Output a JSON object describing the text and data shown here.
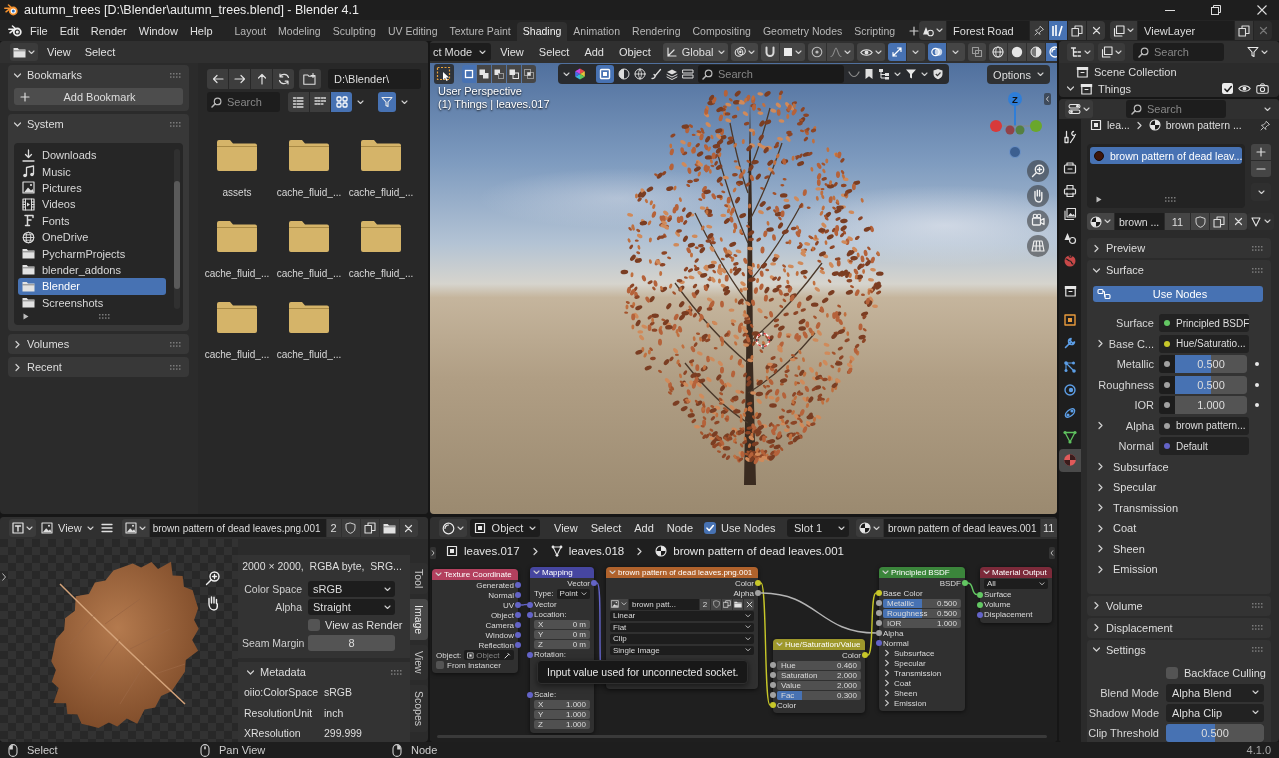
{
  "window": {
    "title": "autumn_trees [D:\\Blender\\autumn_trees.blend] - Blender 4.1"
  },
  "menu": [
    "File",
    "Edit",
    "Render",
    "Window",
    "Help"
  ],
  "workspaces": [
    {
      "label": "Layout",
      "selected": false
    },
    {
      "label": "Modeling",
      "selected": false
    },
    {
      "label": "Sculpting",
      "selected": false
    },
    {
      "label": "UV Editing",
      "selected": false
    },
    {
      "label": "Texture Paint",
      "selected": false
    },
    {
      "label": "Shading",
      "selected": true
    },
    {
      "label": "Animation",
      "selected": false
    },
    {
      "label": "Rendering",
      "selected": false
    },
    {
      "label": "Compositing",
      "selected": false
    },
    {
      "label": "Geometry Nodes",
      "selected": false
    },
    {
      "label": "Scripting",
      "selected": false
    }
  ],
  "scene": {
    "name": "Forest Road"
  },
  "view_layer": {
    "name": "ViewLayer"
  },
  "file_browser": {
    "menu": [
      "View",
      "Select"
    ],
    "panels": [
      {
        "kind": "bookmarks",
        "title": "Bookmarks",
        "expanded": true,
        "button": "Add Bookmark"
      },
      {
        "kind": "system",
        "title": "System",
        "expanded": true,
        "items": [
          {
            "kind": "download",
            "label": "Downloads",
            "selected": false
          },
          {
            "kind": "music",
            "label": "Music",
            "selected": false
          },
          {
            "kind": "pictures",
            "label": "Pictures",
            "selected": false
          },
          {
            "kind": "videos",
            "label": "Videos",
            "selected": false
          },
          {
            "kind": "fonts",
            "label": "Fonts",
            "selected": false
          },
          {
            "kind": "network",
            "label": "OneDrive",
            "selected": false
          },
          {
            "kind": "folder",
            "label": "PycharmProjects",
            "selected": false
          },
          {
            "kind": "folder",
            "label": "blender_addons",
            "selected": false
          },
          {
            "kind": "folder",
            "label": "Blender",
            "selected": true
          },
          {
            "kind": "folder",
            "label": "Screenshots",
            "selected": false
          }
        ]
      },
      {
        "title": "Volumes",
        "expanded": false
      },
      {
        "title": "Recent",
        "expanded": false
      }
    ],
    "path": "D:\\Blender\\",
    "search": {
      "placeholder": "Search"
    },
    "display_modes": [
      {
        "kind": "vertical_list",
        "selected": false
      },
      {
        "kind": "horizontal_list",
        "selected": false
      },
      {
        "kind": "thumbnails",
        "selected": true
      }
    ],
    "filter_on": true,
    "files": [
      "assets",
      "cache_fluid_...",
      "cache_fluid_...",
      "cache_fluid_...",
      "cache_fluid_...",
      "cache_fluid_...",
      "cache_fluid_...",
      "cache_fluid_..."
    ]
  },
  "viewport": {
    "mode": "ct Mode",
    "menu": [
      "View",
      "Select",
      "Add",
      "Object"
    ],
    "orientation": "Global",
    "toggles": {
      "snap": false,
      "proportional": false,
      "gizmos": true,
      "overlays": true,
      "xray": false
    },
    "shading": [
      {
        "kind": "wireframe",
        "selected": false
      },
      {
        "kind": "solid",
        "selected": false
      },
      {
        "kind": "material",
        "selected": false
      },
      {
        "kind": "rendered",
        "selected": true
      }
    ],
    "select_modes": [
      {
        "kind": "set",
        "selected": true
      },
      {
        "kind": "extend",
        "selected": false
      },
      {
        "kind": "subtract",
        "selected": false
      },
      {
        "kind": "invert",
        "selected": false
      },
      {
        "kind": "intersect",
        "selected": false
      }
    ],
    "search": {
      "placeholder": "Search"
    },
    "options": "Options",
    "overlay_text": [
      "User Perspective",
      "(1) Things | leaves.017"
    ],
    "axis_label": "Z"
  },
  "image_editor": {
    "menu": [
      "View"
    ],
    "image": {
      "name": "brown pattern of dead leaves.png.001",
      "users": "2"
    },
    "info": "2000 × 2000,  RGBA byte,  SRG...",
    "fields": [
      {
        "kind": "dropdown",
        "label": "Color Space",
        "value": "sRGB"
      },
      {
        "kind": "dropdown",
        "label": "Alpha",
        "value": "Straight"
      },
      {
        "kind": "checkbox",
        "label": "View as Render",
        "checked": false
      },
      {
        "kind": "number",
        "label": "Seam Margin",
        "value": "8"
      }
    ],
    "metadata": {
      "title": "Metadata",
      "expanded": true,
      "rows": [
        {
          "key": "oiio:ColorSpace",
          "value": "sRGB"
        },
        {
          "key": "ResolutionUnit",
          "value": "inch"
        },
        {
          "key": "XResolution",
          "value": "299.999"
        }
      ]
    },
    "tabs": [
      {
        "label": "Tool",
        "selected": false
      },
      {
        "label": "Image",
        "selected": true
      },
      {
        "label": "View",
        "selected": false
      },
      {
        "label": "Scopes",
        "selected": false
      }
    ]
  },
  "node_editor": {
    "object_type": "Object",
    "menu": [
      "View",
      "Select",
      "Add",
      "Node"
    ],
    "use_nodes": {
      "label": "Use Nodes",
      "checked": true
    },
    "slot": "Slot 1",
    "material": {
      "name": "brown pattern of dead leaves.001",
      "users": "11"
    },
    "breadcrumbs": [
      {
        "kind": "object",
        "label": "leaves.017"
      },
      {
        "kind": "mesh",
        "label": "leaves.018"
      },
      {
        "kind": "material",
        "label": "brown pattern of dead leaves.001"
      }
    ],
    "nodes": [
      {
        "title": "Texture Coordinate",
        "color": "#b3405e",
        "rows": [
          {
            "kind": "output",
            "label": "Generated",
            "color": "#6363c7"
          },
          {
            "kind": "output",
            "label": "Normal",
            "color": "#6363c7"
          },
          {
            "kind": "output",
            "label": "UV",
            "color": "#6363c7"
          },
          {
            "kind": "output",
            "label": "Object",
            "color": "#6363c7"
          },
          {
            "kind": "output",
            "label": "Camera",
            "color": "#6363c7"
          },
          {
            "kind": "output",
            "label": "Window",
            "color": "#6363c7"
          },
          {
            "kind": "output",
            "label": "Reflection",
            "color": "#6363c7"
          },
          {
            "kind": "object_field",
            "label": "Object:",
            "placeholder": "Object"
          },
          {
            "kind": "checkbox",
            "label": "From Instancer",
            "checked": false
          }
        ]
      },
      {
        "title": "Mapping",
        "color": "#4646a0",
        "rows": [
          {
            "kind": "output",
            "label": "Vector",
            "color": "#6363c7"
          },
          {
            "kind": "dropdown",
            "label": "Type:",
            "value": "Point"
          },
          {
            "kind": "input",
            "label": "Vector",
            "color": "#6363c7"
          },
          {
            "kind": "input",
            "label": "Location:",
            "color": "#6363c7"
          },
          {
            "kind": "field",
            "label": "X",
            "value": "0 m"
          },
          {
            "kind": "field",
            "label": "Y",
            "value": "0 m"
          },
          {
            "kind": "field",
            "label": "Z",
            "value": "0 m"
          },
          {
            "kind": "input",
            "label": "Rotation:",
            "color": "#6363c7"
          },
          {
            "kind": "blank"
          },
          {
            "kind": "blank"
          },
          {
            "kind": "blank"
          },
          {
            "kind": "input",
            "label": "Scale:",
            "color": "#6363c7"
          },
          {
            "kind": "field",
            "label": "X",
            "value": "1.000"
          },
          {
            "kind": "field",
            "label": "Y",
            "value": "1.000"
          },
          {
            "kind": "field",
            "label": "Z",
            "value": "1.000"
          }
        ]
      },
      {
        "title": "brown pattern of dead leaves.png.001",
        "color": "#b0622c",
        "rows": [
          {
            "kind": "output",
            "label": "Color",
            "color": "#c7c729"
          },
          {
            "kind": "output",
            "label": "Alpha",
            "color": "#a1a1a1"
          },
          {
            "kind": "image_select",
            "value": "brown patt...",
            "users": "2"
          },
          {
            "kind": "dropdown",
            "value": "Linear"
          },
          {
            "kind": "dropdown",
            "value": "Flat"
          },
          {
            "kind": "dropdown",
            "value": "Clip"
          },
          {
            "kind": "dropdown",
            "value": "Single Image"
          },
          {
            "kind": "blank"
          },
          {
            "kind": "blank"
          },
          {
            "kind": "blank"
          }
        ]
      },
      {
        "title": "Hue/Saturation/Value",
        "color": "#9e982c",
        "rows": [
          {
            "kind": "output",
            "label": "Color",
            "color": "#c7c729"
          },
          {
            "kind": "field",
            "label": "Hue",
            "value": "0.460",
            "color": "#a1a1a1"
          },
          {
            "kind": "field",
            "label": "Saturation",
            "value": "2.000",
            "color": "#a1a1a1"
          },
          {
            "kind": "field",
            "label": "Value",
            "value": "2.000",
            "color": "#a1a1a1"
          },
          {
            "kind": "slider",
            "label": "Fac",
            "value": "0.300",
            "level": 0.3,
            "color": "#a1a1a1"
          },
          {
            "kind": "input",
            "label": "Color",
            "color": "#c7c729"
          }
        ]
      },
      {
        "title": "Principled BSDF",
        "color": "#3b853b",
        "rows": [
          {
            "kind": "output",
            "label": "BSDF",
            "color": "#63c763"
          },
          {
            "kind": "input",
            "label": "Base Color",
            "color": "#c7c729"
          },
          {
            "kind": "slider",
            "label": "Metallic",
            "value": "0.500",
            "level": 0.5,
            "color": "#a1a1a1"
          },
          {
            "kind": "slider",
            "label": "Roughness",
            "value": "0.500",
            "level": 0.5,
            "color": "#a1a1a1"
          },
          {
            "kind": "field",
            "label": "IOR",
            "value": "1.000",
            "color": "#a1a1a1"
          },
          {
            "kind": "input",
            "label": "Alpha",
            "color": "#a1a1a1"
          },
          {
            "kind": "input",
            "label": "Normal",
            "color": "#6363c7"
          },
          {
            "kind": "panel",
            "label": "Subsurface",
            "expanded": false
          },
          {
            "kind": "panel",
            "label": "Specular",
            "expanded": false
          },
          {
            "kind": "panel",
            "label": "Transmission",
            "expanded": false
          },
          {
            "kind": "panel",
            "label": "Coat",
            "expanded": false
          },
          {
            "kind": "panel",
            "label": "Sheen",
            "expanded": false
          },
          {
            "kind": "panel",
            "label": "Emission",
            "expanded": false
          }
        ]
      },
      {
        "title": "Material Output",
        "color": "#7c2a3a",
        "rows": [
          {
            "kind": "dropdown",
            "value": "All"
          },
          {
            "kind": "input",
            "label": "Surface",
            "color": "#63c763"
          },
          {
            "kind": "input",
            "label": "Volume",
            "color": "#63c763"
          },
          {
            "kind": "input",
            "label": "Displacement",
            "color": "#6363c7"
          }
        ]
      }
    ],
    "links": [
      {
        "color": "#6363c7"
      },
      {
        "color": "#6363c7"
      },
      {
        "color": "#c7c729"
      },
      {
        "color": "#b4b4b4"
      },
      {
        "color": "#c7c729"
      },
      {
        "color": "#63c763"
      }
    ],
    "tooltip": "Input value used for unconnected socket."
  },
  "outliner": {
    "search": {
      "placeholder": "Search"
    },
    "rows": [
      {
        "kind": "scene_collection",
        "label": "Scene Collection"
      },
      {
        "kind": "collection",
        "label": "Things",
        "expanded": true,
        "checked": true
      }
    ]
  },
  "properties": {
    "search": {
      "placeholder": "Search"
    },
    "tabs": [
      {
        "kind": "tool",
        "selected": false
      },
      {
        "kind": "render",
        "selected": false
      },
      {
        "kind": "output",
        "selected": false
      },
      {
        "kind": "view_layer",
        "selected": false
      },
      {
        "kind": "scene",
        "selected": false
      },
      {
        "kind": "world",
        "selected": false
      },
      {
        "kind": "collection",
        "selected": false
      },
      {
        "kind": "object",
        "selected": false
      },
      {
        "kind": "modifiers",
        "selected": false
      },
      {
        "kind": "particles",
        "selected": false
      },
      {
        "kind": "physics",
        "selected": false
      },
      {
        "kind": "constraints",
        "selected": false
      },
      {
        "kind": "data",
        "selected": false
      },
      {
        "kind": "material",
        "selected": true
      }
    ],
    "breadcrumb": [
      "lea...",
      "brown pattern ..."
    ],
    "slots": [
      {
        "label": "brown pattern of dead leav...",
        "selected": true
      }
    ],
    "material": {
      "name": "brown ...",
      "users": "11"
    },
    "panels": [
      {
        "title": "Preview",
        "expanded": false
      },
      {
        "kind": "surface",
        "title": "Surface",
        "expanded": true,
        "use_nodes": {
          "label": "Use Nodes",
          "on": true
        },
        "rows": [
          {
            "kind": "link",
            "label": "Surface",
            "value": "Principled BSDF",
            "color": "#63c763"
          },
          {
            "kind": "link",
            "label": "Base C...",
            "value": "Hue/Saturatio...",
            "color": "#c7c729",
            "expanded": false
          },
          {
            "kind": "slider",
            "label": "Metallic",
            "value": "0.500",
            "level": 0.5,
            "color": "#a1a1a1"
          },
          {
            "kind": "slider",
            "label": "Roughness",
            "value": "0.500",
            "level": 0.5,
            "color": "#a1a1a1"
          },
          {
            "kind": "number",
            "label": "IOR",
            "value": "1.000",
            "color": "#a1a1a1"
          },
          {
            "kind": "link",
            "label": "Alpha",
            "value": "brown pattern...",
            "color": "#a1a1a1",
            "expanded": false
          },
          {
            "kind": "link",
            "label": "Normal",
            "value": "Default",
            "color": "#6363c7"
          },
          {
            "kind": "subpanel",
            "label": "Subsurface",
            "expanded": false
          },
          {
            "kind": "subpanel",
            "label": "Specular",
            "expanded": false
          },
          {
            "kind": "subpanel",
            "label": "Transmission",
            "expanded": false
          },
          {
            "kind": "subpanel",
            "label": "Coat",
            "expanded": false
          },
          {
            "kind": "subpanel",
            "label": "Sheen",
            "expanded": false
          },
          {
            "kind": "subpanel",
            "label": "Emission",
            "expanded": false
          }
        ]
      },
      {
        "title": "Volume",
        "expanded": false
      },
      {
        "title": "Displacement",
        "expanded": false
      },
      {
        "kind": "settings",
        "title": "Settings",
        "expanded": true,
        "rows": [
          {
            "kind": "checkbox",
            "label": "Backface Culling",
            "checked": false
          },
          {
            "kind": "dropdown",
            "label": "Blend Mode",
            "value": "Alpha Blend"
          },
          {
            "kind": "dropdown",
            "label": "Shadow Mode",
            "value": "Alpha Clip"
          },
          {
            "kind": "slider",
            "label": "Clip Threshold",
            "value": "0.500",
            "level": 0.5
          }
        ]
      }
    ]
  },
  "status_bar": {
    "hints": [
      {
        "kind": "left_click",
        "label": "Select"
      },
      {
        "kind": "middle_click",
        "label": "Pan View"
      },
      {
        "kind": "right_click",
        "label": "Node"
      }
    ],
    "version": "4.1.0"
  }
}
